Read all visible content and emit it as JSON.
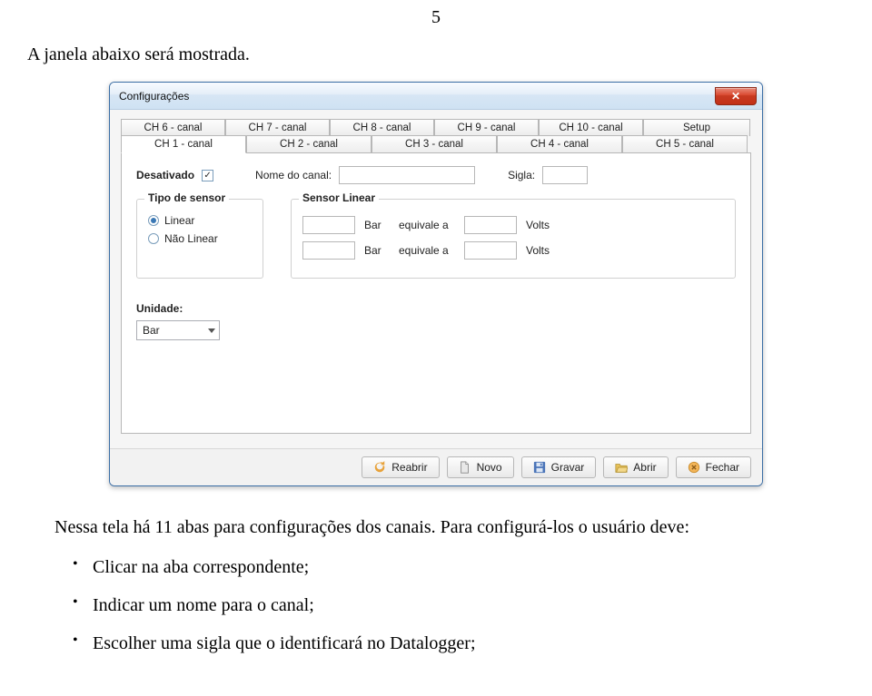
{
  "page_number": "5",
  "intro_text": "A janela abaixo será mostrada.",
  "dialog": {
    "title": "Configurações",
    "tabs_top": [
      "CH 6 - canal",
      "CH 7 - canal",
      "CH 8 - canal",
      "CH 9 - canal",
      "CH 10 - canal",
      "Setup"
    ],
    "tabs_bottom": [
      "CH 1 - canal",
      "CH 2 - canal",
      "CH 3 - canal",
      "CH 4 - canal",
      "CH 5 - canal"
    ],
    "active_tab": "CH 1 - canal",
    "desativado_label": "Desativado",
    "desativado_checked": true,
    "nome_canal_label": "Nome do canal:",
    "nome_canal_value": "",
    "sigla_label": "Sigla:",
    "sigla_value": "",
    "group_sensor_title": "Tipo de sensor",
    "sensor_linear_label": "Linear",
    "sensor_naolinear_label": "Não Linear",
    "sensor_selected": "Linear",
    "group_linear_title": "Sensor Linear",
    "linear_rows": [
      {
        "v1": "",
        "unit1": "Bar",
        "eq": "equivale a",
        "v2": "",
        "unit2": "Volts"
      },
      {
        "v1": "",
        "unit1": "Bar",
        "eq": "equivale a",
        "v2": "",
        "unit2": "Volts"
      }
    ],
    "unidade_label": "Unidade:",
    "unidade_value": "Bar",
    "buttons": {
      "reabrir": "Reabrir",
      "novo": "Novo",
      "gravar": "Gravar",
      "abrir": "Abrir",
      "fechar": "Fechar"
    }
  },
  "after_text": "Nessa tela há 11 abas para configurações dos canais. Para configurá-los o usuário deve:",
  "bullets": [
    "Clicar na aba correspondente;",
    "Indicar um nome para o canal;",
    "Escolher uma sigla que o identificará no Datalogger;"
  ]
}
